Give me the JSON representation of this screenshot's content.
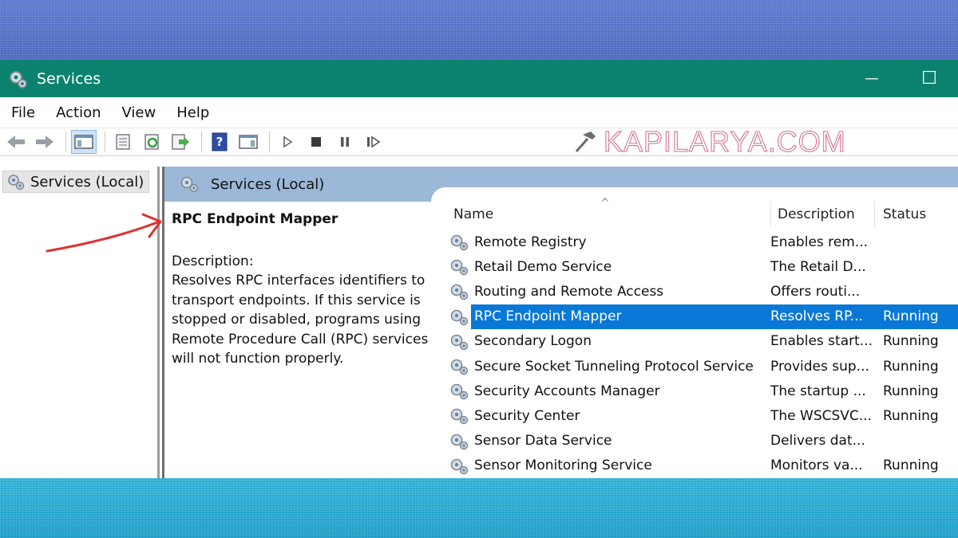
{
  "window": {
    "title": "Services",
    "minimize_glyph": "—",
    "maximize_glyph": "☐"
  },
  "menu": {
    "items": [
      "File",
      "Action",
      "View",
      "Help"
    ]
  },
  "toolbar": {
    "icons": [
      "back-arrow-icon",
      "forward-arrow-icon",
      "show-console-tree-icon",
      "properties-icon",
      "refresh-icon",
      "export-list-icon",
      "help-icon",
      "show-action-pane-icon",
      "start-service-icon",
      "stop-service-icon",
      "pause-service-icon",
      "restart-service-icon"
    ]
  },
  "watermark": {
    "text": "KAPILARYA.COM"
  },
  "tree": {
    "root_label": "Services (Local)"
  },
  "pane": {
    "header_title": "Services (Local)",
    "selected_service_name": "RPC Endpoint Mapper",
    "description_label": "Description:",
    "description_text": "Resolves RPC interfaces identifiers to transport endpoints. If this service is stopped or disabled, programs using Remote Procedure Call (RPC) services will not function properly."
  },
  "list": {
    "columns": {
      "name": "Name",
      "description": "Description",
      "status": "Status"
    },
    "rows": [
      {
        "name": "Remote Registry",
        "description": "Enables rem...",
        "status": ""
      },
      {
        "name": "Retail Demo Service",
        "description": "The Retail D...",
        "status": ""
      },
      {
        "name": "Routing and Remote Access",
        "description": "Offers routi...",
        "status": ""
      },
      {
        "name": "RPC Endpoint Mapper",
        "description": "Resolves RP...",
        "status": "Running"
      },
      {
        "name": "Secondary Logon",
        "description": "Enables start...",
        "status": "Running"
      },
      {
        "name": "Secure Socket Tunneling Protocol Service",
        "description": "Provides sup...",
        "status": "Running"
      },
      {
        "name": "Security Accounts Manager",
        "description": "The startup ...",
        "status": "Running"
      },
      {
        "name": "Security Center",
        "description": "The WSCSVC...",
        "status": "Running"
      },
      {
        "name": "Sensor Data Service",
        "description": "Delivers dat...",
        "status": ""
      },
      {
        "name": "Sensor Monitoring Service",
        "description": "Monitors va...",
        "status": "Running"
      }
    ],
    "selected_index": 3
  },
  "colors": {
    "titlebar": "#0b8270",
    "selection": "#0a78d7",
    "pane_header": "#9cb8d8",
    "annotation_arrow": "#e03030"
  }
}
